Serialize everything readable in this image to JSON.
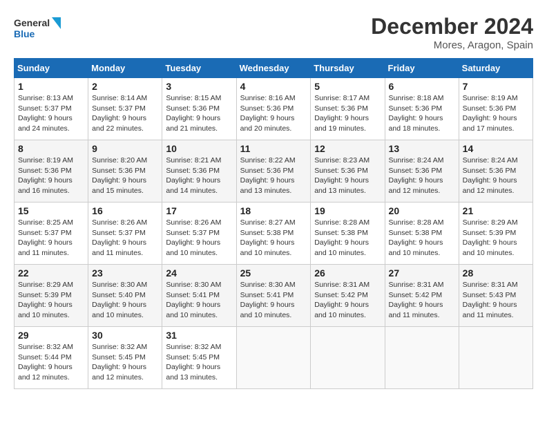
{
  "header": {
    "logo_line1": "General",
    "logo_line2": "Blue",
    "month_title": "December 2024",
    "subtitle": "Mores, Aragon, Spain"
  },
  "weekdays": [
    "Sunday",
    "Monday",
    "Tuesday",
    "Wednesday",
    "Thursday",
    "Friday",
    "Saturday"
  ],
  "weeks": [
    [
      {
        "day": "1",
        "info": "Sunrise: 8:13 AM\nSunset: 5:37 PM\nDaylight: 9 hours\nand 24 minutes."
      },
      {
        "day": "2",
        "info": "Sunrise: 8:14 AM\nSunset: 5:37 PM\nDaylight: 9 hours\nand 22 minutes."
      },
      {
        "day": "3",
        "info": "Sunrise: 8:15 AM\nSunset: 5:36 PM\nDaylight: 9 hours\nand 21 minutes."
      },
      {
        "day": "4",
        "info": "Sunrise: 8:16 AM\nSunset: 5:36 PM\nDaylight: 9 hours\nand 20 minutes."
      },
      {
        "day": "5",
        "info": "Sunrise: 8:17 AM\nSunset: 5:36 PM\nDaylight: 9 hours\nand 19 minutes."
      },
      {
        "day": "6",
        "info": "Sunrise: 8:18 AM\nSunset: 5:36 PM\nDaylight: 9 hours\nand 18 minutes."
      },
      {
        "day": "7",
        "info": "Sunrise: 8:19 AM\nSunset: 5:36 PM\nDaylight: 9 hours\nand 17 minutes."
      }
    ],
    [
      {
        "day": "8",
        "info": "Sunrise: 8:19 AM\nSunset: 5:36 PM\nDaylight: 9 hours\nand 16 minutes."
      },
      {
        "day": "9",
        "info": "Sunrise: 8:20 AM\nSunset: 5:36 PM\nDaylight: 9 hours\nand 15 minutes."
      },
      {
        "day": "10",
        "info": "Sunrise: 8:21 AM\nSunset: 5:36 PM\nDaylight: 9 hours\nand 14 minutes."
      },
      {
        "day": "11",
        "info": "Sunrise: 8:22 AM\nSunset: 5:36 PM\nDaylight: 9 hours\nand 13 minutes."
      },
      {
        "day": "12",
        "info": "Sunrise: 8:23 AM\nSunset: 5:36 PM\nDaylight: 9 hours\nand 13 minutes."
      },
      {
        "day": "13",
        "info": "Sunrise: 8:24 AM\nSunset: 5:36 PM\nDaylight: 9 hours\nand 12 minutes."
      },
      {
        "day": "14",
        "info": "Sunrise: 8:24 AM\nSunset: 5:36 PM\nDaylight: 9 hours\nand 12 minutes."
      }
    ],
    [
      {
        "day": "15",
        "info": "Sunrise: 8:25 AM\nSunset: 5:37 PM\nDaylight: 9 hours\nand 11 minutes."
      },
      {
        "day": "16",
        "info": "Sunrise: 8:26 AM\nSunset: 5:37 PM\nDaylight: 9 hours\nand 11 minutes."
      },
      {
        "day": "17",
        "info": "Sunrise: 8:26 AM\nSunset: 5:37 PM\nDaylight: 9 hours\nand 10 minutes."
      },
      {
        "day": "18",
        "info": "Sunrise: 8:27 AM\nSunset: 5:38 PM\nDaylight: 9 hours\nand 10 minutes."
      },
      {
        "day": "19",
        "info": "Sunrise: 8:28 AM\nSunset: 5:38 PM\nDaylight: 9 hours\nand 10 minutes."
      },
      {
        "day": "20",
        "info": "Sunrise: 8:28 AM\nSunset: 5:38 PM\nDaylight: 9 hours\nand 10 minutes."
      },
      {
        "day": "21",
        "info": "Sunrise: 8:29 AM\nSunset: 5:39 PM\nDaylight: 9 hours\nand 10 minutes."
      }
    ],
    [
      {
        "day": "22",
        "info": "Sunrise: 8:29 AM\nSunset: 5:39 PM\nDaylight: 9 hours\nand 10 minutes."
      },
      {
        "day": "23",
        "info": "Sunrise: 8:30 AM\nSunset: 5:40 PM\nDaylight: 9 hours\nand 10 minutes."
      },
      {
        "day": "24",
        "info": "Sunrise: 8:30 AM\nSunset: 5:41 PM\nDaylight: 9 hours\nand 10 minutes."
      },
      {
        "day": "25",
        "info": "Sunrise: 8:30 AM\nSunset: 5:41 PM\nDaylight: 9 hours\nand 10 minutes."
      },
      {
        "day": "26",
        "info": "Sunrise: 8:31 AM\nSunset: 5:42 PM\nDaylight: 9 hours\nand 10 minutes."
      },
      {
        "day": "27",
        "info": "Sunrise: 8:31 AM\nSunset: 5:42 PM\nDaylight: 9 hours\nand 11 minutes."
      },
      {
        "day": "28",
        "info": "Sunrise: 8:31 AM\nSunset: 5:43 PM\nDaylight: 9 hours\nand 11 minutes."
      }
    ],
    [
      {
        "day": "29",
        "info": "Sunrise: 8:32 AM\nSunset: 5:44 PM\nDaylight: 9 hours\nand 12 minutes."
      },
      {
        "day": "30",
        "info": "Sunrise: 8:32 AM\nSunset: 5:45 PM\nDaylight: 9 hours\nand 12 minutes."
      },
      {
        "day": "31",
        "info": "Sunrise: 8:32 AM\nSunset: 5:45 PM\nDaylight: 9 hours\nand 13 minutes."
      },
      {
        "day": "",
        "info": ""
      },
      {
        "day": "",
        "info": ""
      },
      {
        "day": "",
        "info": ""
      },
      {
        "day": "",
        "info": ""
      }
    ]
  ]
}
